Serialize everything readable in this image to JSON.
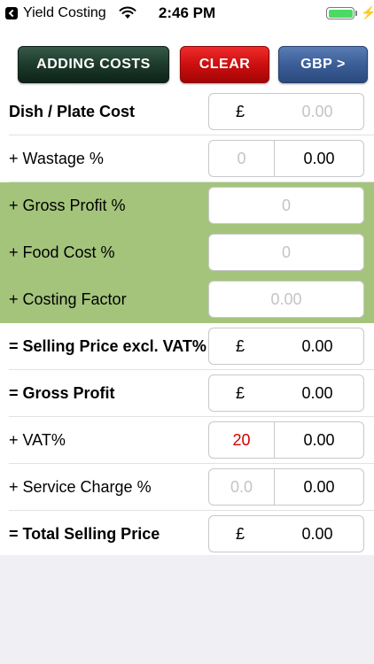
{
  "status_bar": {
    "app_name": "Yield Costing",
    "time": "2:46 PM",
    "charge_symbol": "⚡"
  },
  "toolbar": {
    "adding_costs_label": "ADDING COSTS",
    "clear_label": "CLEAR",
    "currency_label": "GBP >"
  },
  "rows": {
    "dish_plate_cost": {
      "label": "Dish / Plate Cost",
      "currency": "£",
      "placeholder": "0.00"
    },
    "wastage": {
      "label": "+ Wastage %",
      "percent_placeholder": "0",
      "value": "0.00"
    },
    "gross_profit_pct": {
      "label": "+  Gross Profit %",
      "placeholder": "0"
    },
    "food_cost_pct": {
      "label": "+  Food Cost %",
      "placeholder": "0"
    },
    "costing_factor": {
      "label": "+  Costing Factor",
      "placeholder": "0.00"
    },
    "selling_price_excl_vat": {
      "label": "= Selling Price excl. VAT%",
      "currency": "£",
      "value": "0.00"
    },
    "gross_profit": {
      "label": "= Gross Profit",
      "currency": "£",
      "value": "0.00"
    },
    "vat": {
      "label": "+ VAT%",
      "percent": "20",
      "value": "0.00"
    },
    "service_charge": {
      "label": "+ Service Charge %",
      "percent_placeholder": "0.0",
      "value": "0.00"
    },
    "total_selling_price": {
      "label": "= Total Selling Price",
      "currency": "£",
      "value": "0.00"
    }
  },
  "colors": {
    "green_section": "#a4c47c",
    "adding_costs_button": "#1d3a2c",
    "clear_button": "#cc0f0f",
    "currency_button": "#3b5e98",
    "vat_value": "#d40000",
    "battery": "#4cd964"
  },
  "icons": {
    "back": "back-icon",
    "wifi": "wifi-icon",
    "battery": "battery-icon",
    "charging": "charging-icon"
  }
}
